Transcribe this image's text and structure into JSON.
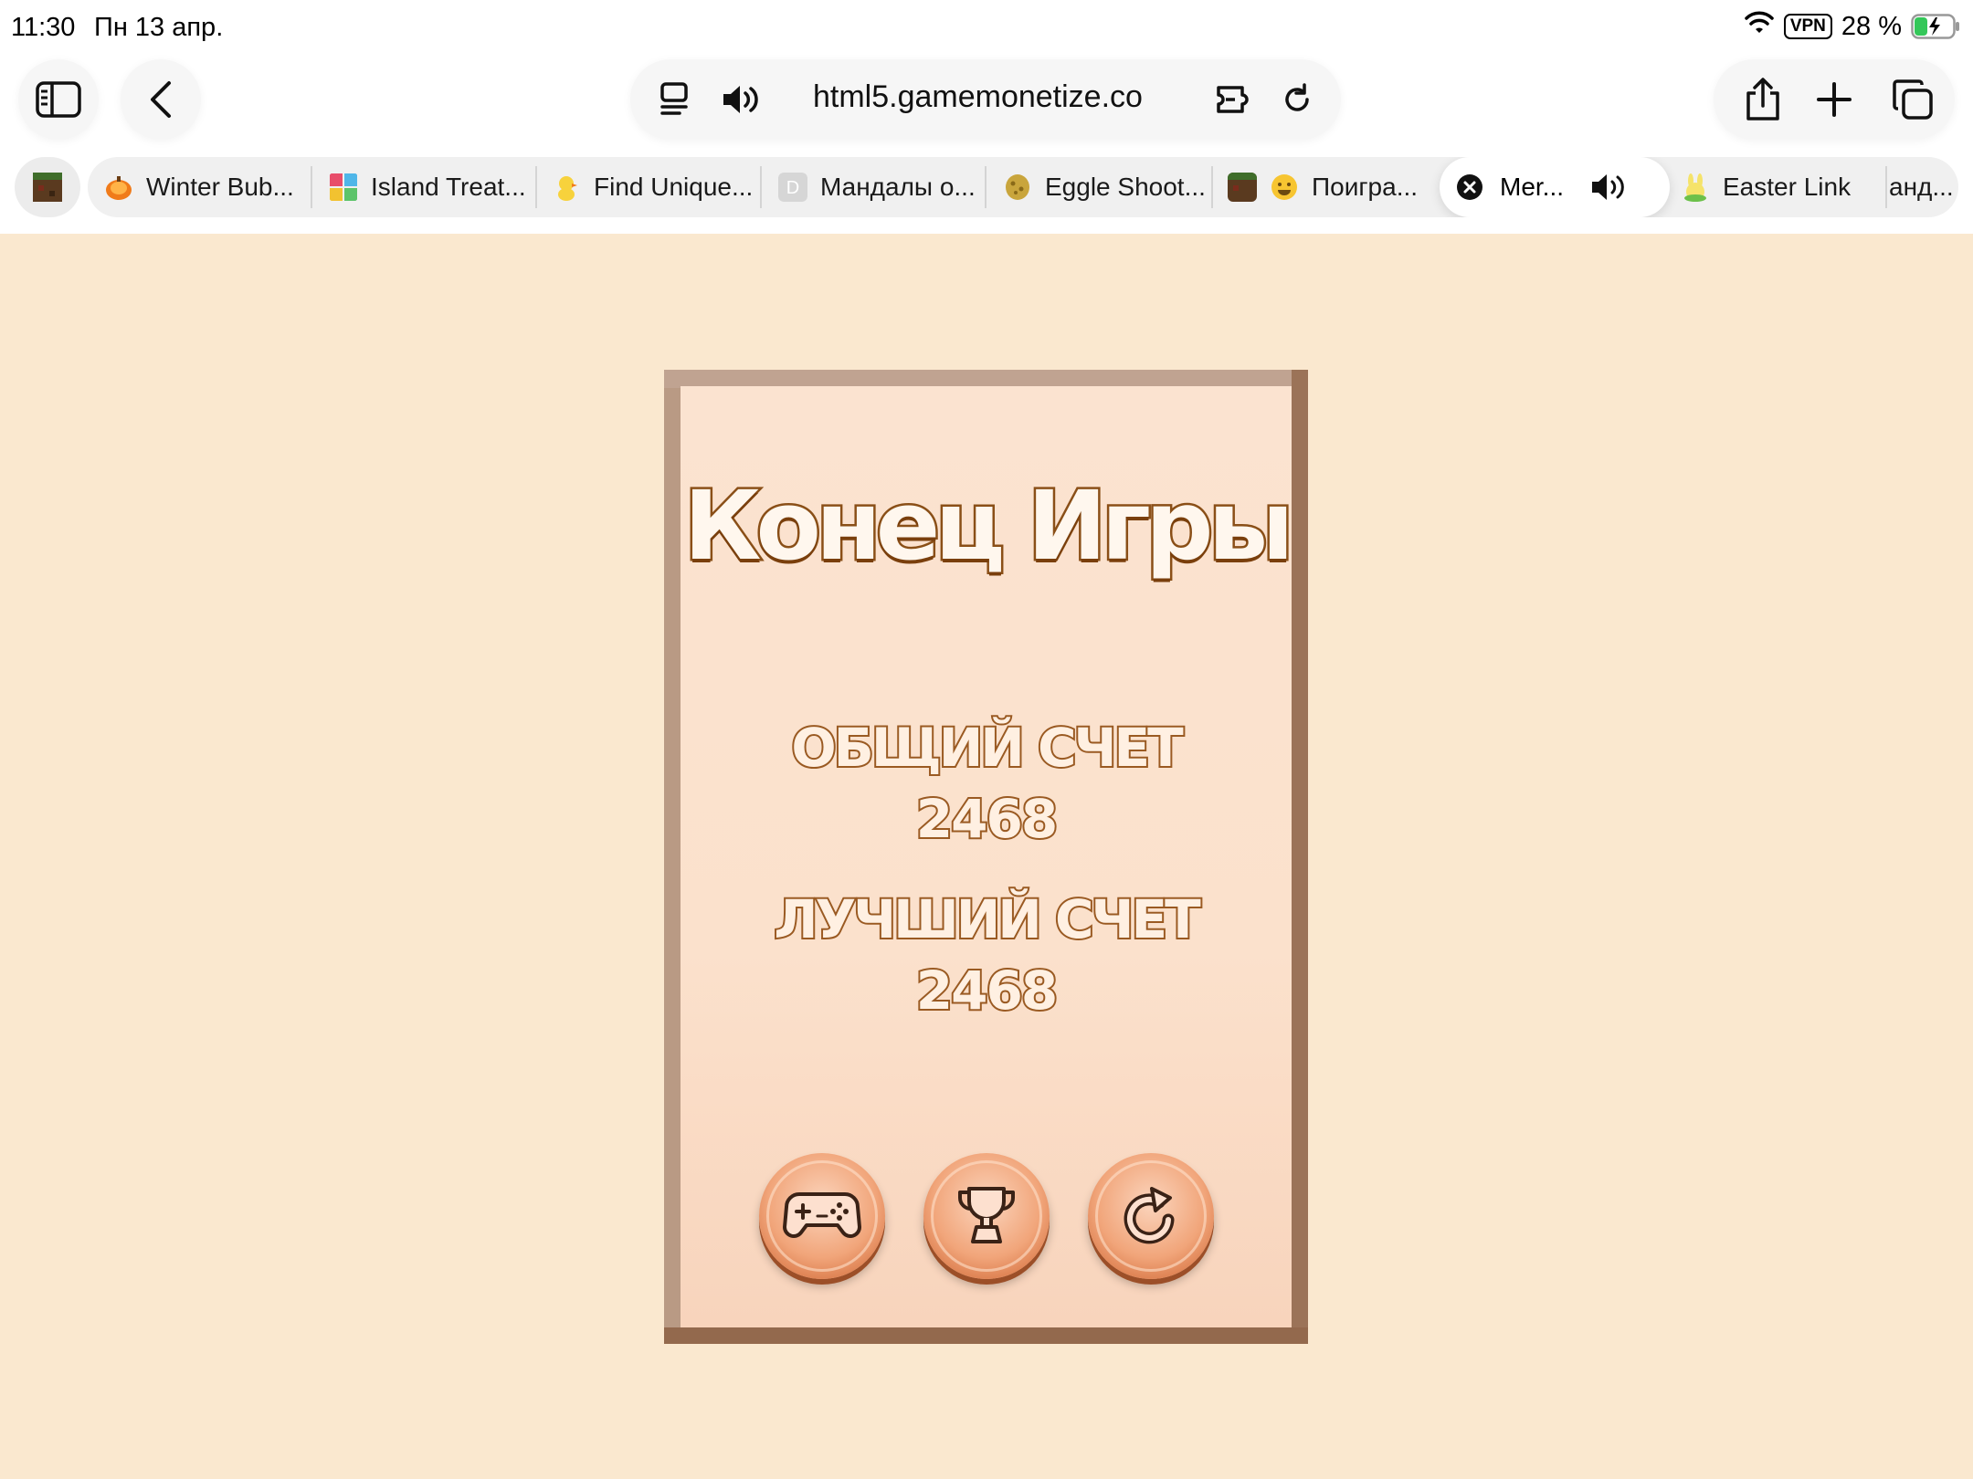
{
  "status_bar": {
    "time": "11:30",
    "date": "Пн 13 апр.",
    "vpn": "VPN",
    "battery": "28 %"
  },
  "toolbar": {
    "url": "html5.gamemonetize.co"
  },
  "tabs": [
    {
      "label": "Winter Bub...",
      "icon": "pumpkin-favicon"
    },
    {
      "label": "Island Treat...",
      "icon": "puzzle-favicon"
    },
    {
      "label": "Find Unique...",
      "icon": "chick-favicon"
    },
    {
      "label": "Мандалы о...",
      "icon": "letter-d-favicon"
    },
    {
      "label": "Eggle Shoot...",
      "icon": "egg-favicon"
    },
    {
      "label": "Поигра...",
      "icon": "smiley-favicon"
    },
    {
      "label": "Mer...",
      "icon": "close-icon",
      "active": true
    },
    {
      "label": "Easter Link",
      "icon": "bunny-favicon"
    },
    {
      "label": "анд...",
      "icon": ""
    }
  ],
  "game": {
    "title": "Конец Игры",
    "total_label": "ОБЩИЙ СЧЕТ",
    "total_value": "2468",
    "best_label": "ЛУЧШИЙ СЧЕТ",
    "best_value": "2468",
    "buttons": [
      "gamepad-icon",
      "trophy-icon",
      "restart-icon"
    ]
  },
  "colors": {
    "page_background": "#fae8cf",
    "panel_frame": "#b99a84",
    "text_outline": "#8a4f17",
    "button_orange": "#f1a57a"
  }
}
